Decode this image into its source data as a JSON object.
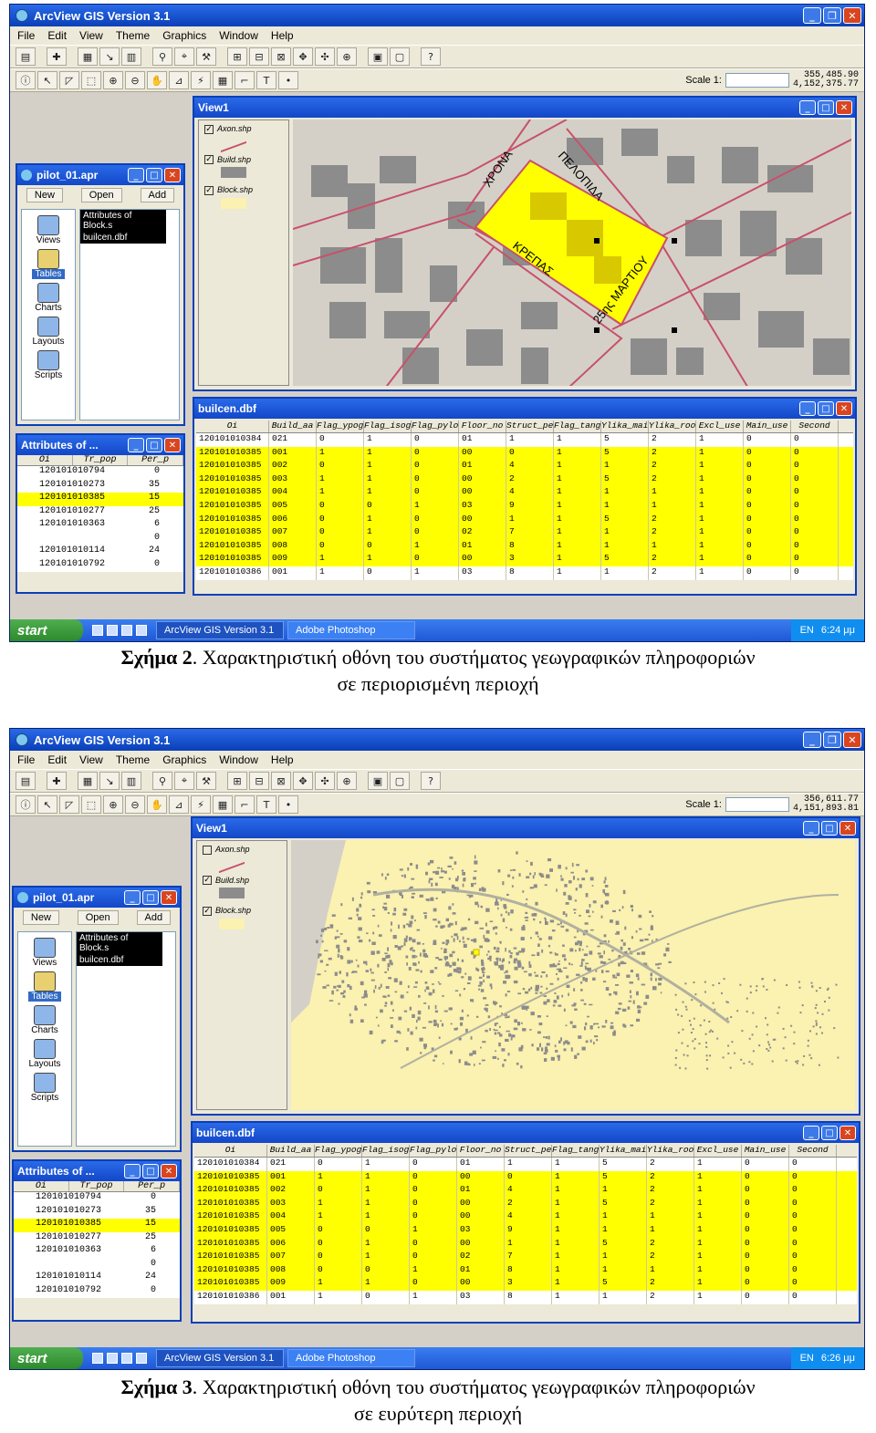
{
  "app_title": "ArcView GIS Version 3.1",
  "menu": [
    "File",
    "Edit",
    "View",
    "Theme",
    "Graphics",
    "Window",
    "Help"
  ],
  "scale_label": "Scale 1:",
  "project": {
    "title": "pilot_01.apr",
    "buttons": [
      "New",
      "Open",
      "Add"
    ],
    "icons": [
      "Views",
      "Tables",
      "Charts",
      "Layouts",
      "Scripts"
    ],
    "selected": "Tables",
    "docs": [
      "Attributes of Block.s",
      "builcen.dbf"
    ]
  },
  "view": {
    "title": "View1",
    "themes": [
      "Axon.shp",
      "Build.shp",
      "Block.shp"
    ],
    "street_labels": [
      "ΧΡΟΝΑ",
      "ΠΕΛΟΠΙΔΑ",
      "ΚΡΕΠΑΣ",
      "25ης ΜΑΡΤΙΟΥ"
    ]
  },
  "small_attr": {
    "title": "Attributes of ...",
    "headers": [
      "Oi",
      "Tr_pop",
      "Per_p"
    ],
    "rows": [
      [
        "120101010794",
        "0"
      ],
      [
        "120101010273",
        "35"
      ],
      [
        "120101010385",
        "15"
      ],
      [
        "120101010277",
        "25"
      ],
      [
        "120101010363",
        "6"
      ],
      [
        "",
        "0"
      ],
      [
        "120101010114",
        "24"
      ],
      [
        "120101010792",
        "0"
      ]
    ],
    "highlight_row": 2
  },
  "table": {
    "title": "builcen.dbf",
    "headers": [
      "Oi",
      "Build_aa",
      "Flag_ypog",
      "Flag_isog",
      "Flag_pylot",
      "Floor_no",
      "Struct_per",
      "Flag_tange",
      "Ylika_main",
      "Ylika_roof",
      "Excl_use",
      "Main_use",
      "Second"
    ],
    "rows": [
      [
        "120101010384",
        "021",
        "0",
        "1",
        "0",
        "01",
        "1",
        "1",
        "5",
        "2",
        "1",
        "0",
        "0"
      ],
      [
        "120101010385",
        "001",
        "1",
        "1",
        "0",
        "00",
        "0",
        "1",
        "5",
        "2",
        "1",
        "0",
        "0"
      ],
      [
        "120101010385",
        "002",
        "0",
        "1",
        "0",
        "01",
        "4",
        "1",
        "1",
        "2",
        "1",
        "0",
        "0"
      ],
      [
        "120101010385",
        "003",
        "1",
        "1",
        "0",
        "00",
        "2",
        "1",
        "5",
        "2",
        "1",
        "0",
        "0"
      ],
      [
        "120101010385",
        "004",
        "1",
        "1",
        "0",
        "00",
        "4",
        "1",
        "1",
        "1",
        "1",
        "0",
        "0"
      ],
      [
        "120101010385",
        "005",
        "0",
        "0",
        "1",
        "03",
        "9",
        "1",
        "1",
        "1",
        "1",
        "0",
        "0"
      ],
      [
        "120101010385",
        "006",
        "0",
        "1",
        "0",
        "00",
        "1",
        "1",
        "5",
        "2",
        "1",
        "0",
        "0"
      ],
      [
        "120101010385",
        "007",
        "0",
        "1",
        "0",
        "02",
        "7",
        "1",
        "1",
        "2",
        "1",
        "0",
        "0"
      ],
      [
        "120101010385",
        "008",
        "0",
        "0",
        "1",
        "01",
        "8",
        "1",
        "1",
        "1",
        "1",
        "0",
        "0"
      ],
      [
        "120101010385",
        "009",
        "1",
        "1",
        "0",
        "00",
        "3",
        "1",
        "5",
        "2",
        "1",
        "0",
        "0"
      ],
      [
        "120101010386",
        "001",
        "1",
        "0",
        "1",
        "03",
        "8",
        "1",
        "1",
        "2",
        "1",
        "0",
        "0"
      ]
    ]
  },
  "taskbar": {
    "start": "start",
    "tasks": [
      "ArcView GIS Version 3.1",
      "Adobe Photoshop"
    ],
    "lang": "EN"
  },
  "fig1": {
    "coords": [
      "355,485.90",
      "4,152,375.77"
    ],
    "time": "6:24 μμ",
    "caption_label": "Σχήμα 2",
    "caption_text": ". Χαρακτηριστική οθόνη του συστήματος γεωγραφικών πληροφοριών",
    "caption_line2": "σε περιορισμένη περιοχή"
  },
  "fig2": {
    "coords": [
      "356,611.77",
      "4,151,893.81"
    ],
    "time": "6:26 μμ",
    "caption_label": "Σχήμα 3",
    "caption_text": ". Χαρακτηριστική οθόνη του συστήματος γεωγραφικών πληροφοριών",
    "caption_line2": "σε ευρύτερη περιοχή"
  },
  "colors": {
    "highlight": "#ffff00",
    "map_bg": "#fbf1b0",
    "building": "#8c8c8c",
    "road": "#c8506a",
    "block_sel": "#ffff00"
  }
}
